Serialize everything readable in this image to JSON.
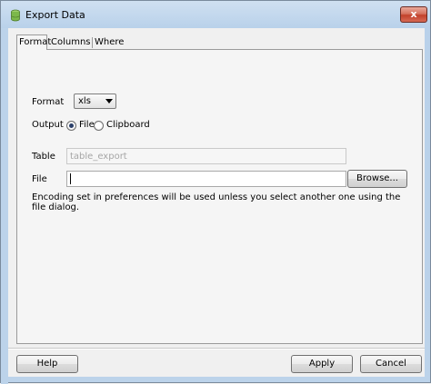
{
  "window": {
    "title": "Export Data",
    "close_glyph": "x",
    "icon": "app-cylinder-icon"
  },
  "tabs": [
    {
      "label": "Format",
      "active": true
    },
    {
      "label": "Columns",
      "active": false
    },
    {
      "label": "Where",
      "active": false
    }
  ],
  "form": {
    "format_label": "Format",
    "format_value": "xls",
    "output_label": "Output",
    "output_options": [
      {
        "label": "File",
        "selected": true
      },
      {
        "label": "Clipboard",
        "selected": false
      }
    ],
    "table_label": "Table",
    "table_value": "table_export",
    "file_label": "File",
    "file_value": "",
    "browse_label": "Browse...",
    "encoding_note": "Encoding set in preferences will be used unless you select another one using the file dialog."
  },
  "footer": {
    "help_label": "Help",
    "apply_label": "Apply",
    "cancel_label": "Cancel"
  },
  "colors": {
    "title_bar": "#b9d1ea",
    "close_button": "#c2412b",
    "dialog_bg": "#f0f0f0"
  }
}
